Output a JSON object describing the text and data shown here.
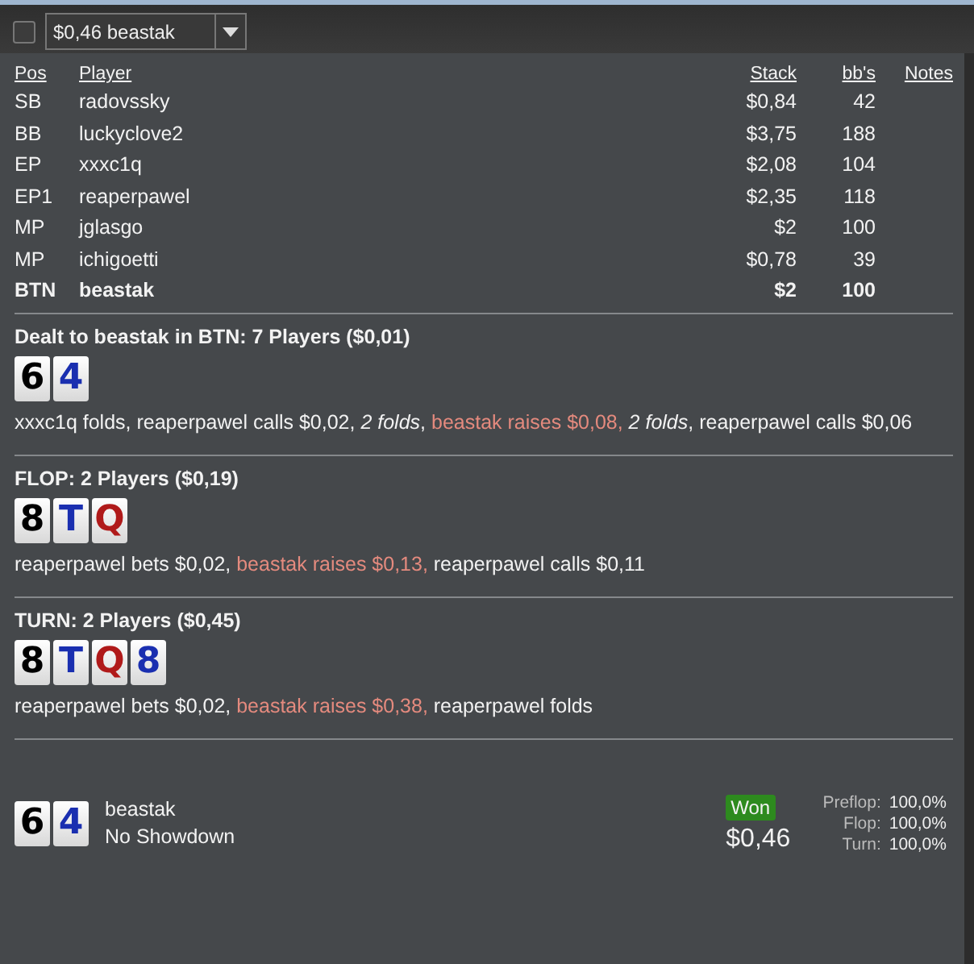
{
  "toolbar": {
    "checked": false,
    "dropdown": {
      "value": "$0,46 beastak"
    }
  },
  "players": {
    "columns": [
      "Pos",
      "Player",
      "Stack",
      "bb's",
      "Notes"
    ],
    "rows": [
      {
        "pos": "SB",
        "player": "radovssky",
        "stack": "$0,84",
        "bbs": "42",
        "hero": false
      },
      {
        "pos": "BB",
        "player": "luckyclove2",
        "stack": "$3,75",
        "bbs": "188",
        "hero": false
      },
      {
        "pos": "EP",
        "player": "xxxc1q",
        "stack": "$2,08",
        "bbs": "104",
        "hero": false
      },
      {
        "pos": "EP1",
        "player": "reaperpawel",
        "stack": "$2,35",
        "bbs": "118",
        "hero": false
      },
      {
        "pos": "MP",
        "player": "jglasgo",
        "stack": "$2",
        "bbs": "100",
        "hero": false
      },
      {
        "pos": "MP",
        "player": "ichigoetti",
        "stack": "$0,78",
        "bbs": "39",
        "hero": false
      },
      {
        "pos": "BTN",
        "player": "beastak",
        "stack": "$2",
        "bbs": "100",
        "hero": true
      }
    ]
  },
  "streets": [
    {
      "title": "Dealt to beastak in BTN: 7 Players ($0,01)",
      "cards": [
        {
          "rank": "6",
          "color": "#000000"
        },
        {
          "rank": "4",
          "color": "#1a2fb0"
        }
      ],
      "actions": [
        {
          "text": "xxxc1q folds, reaperpawel calls $0,02, ",
          "kind": "plain"
        },
        {
          "text": "2 folds",
          "kind": "italic"
        },
        {
          "text": ", ",
          "kind": "plain"
        },
        {
          "text": "beastak raises $0,08, ",
          "kind": "hero"
        },
        {
          "text": "2 folds",
          "kind": "italic"
        },
        {
          "text": ", reaperpawel calls $0,06",
          "kind": "plain"
        }
      ]
    },
    {
      "title": "FLOP: 2 Players ($0,19)",
      "cards": [
        {
          "rank": "8",
          "color": "#000000"
        },
        {
          "rank": "T",
          "color": "#1a2fb0"
        },
        {
          "rank": "Q",
          "color": "#b01a1a"
        }
      ],
      "actions": [
        {
          "text": "reaperpawel bets $0,02, ",
          "kind": "plain"
        },
        {
          "text": "beastak raises $0,13, ",
          "kind": "hero"
        },
        {
          "text": "reaperpawel calls $0,11",
          "kind": "plain"
        }
      ]
    },
    {
      "title": "TURN: 2 Players ($0,45)",
      "cards": [
        {
          "rank": "8",
          "color": "#000000"
        },
        {
          "rank": "T",
          "color": "#1a2fb0"
        },
        {
          "rank": "Q",
          "color": "#b01a1a"
        },
        {
          "rank": "8",
          "color": "#1a2fb0"
        }
      ],
      "actions": [
        {
          "text": "reaperpawel bets $0,02, ",
          "kind": "plain"
        },
        {
          "text": "beastak raises $0,38, ",
          "kind": "hero"
        },
        {
          "text": "reaperpawel folds",
          "kind": "plain"
        }
      ]
    }
  ],
  "result": {
    "cards": [
      {
        "rank": "6",
        "color": "#000000"
      },
      {
        "rank": "4",
        "color": "#1a2fb0"
      }
    ],
    "player": "beastak",
    "showdown": "No Showdown",
    "badge": "Won",
    "amount": "$0,46",
    "equity": [
      {
        "label": "Preflop:",
        "value": "100,0%"
      },
      {
        "label": "Flop:",
        "value": "100,0%"
      },
      {
        "label": "Turn:",
        "value": "100,0%"
      }
    ]
  }
}
